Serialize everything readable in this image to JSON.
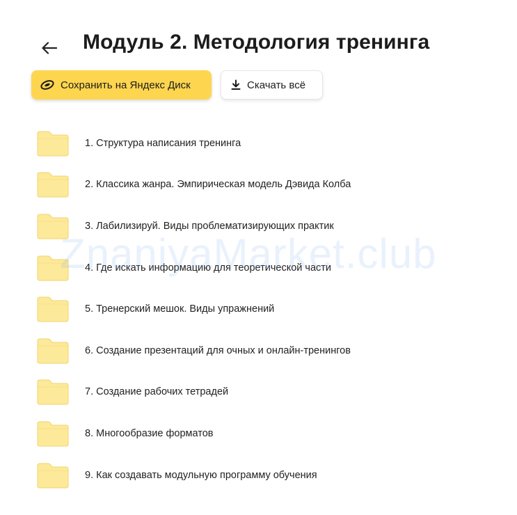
{
  "header": {
    "title": "Модуль 2. Методология тренинга"
  },
  "toolbar": {
    "save_label": "Сохранить на Яндекс Диск",
    "download_label": "Скачать всё"
  },
  "folders": [
    "1. Структура написания тренинга",
    "2. Классика жанра. Эмпирическая модель Дэвида Колба",
    "3. Лабилизируй. Виды проблематизирующих практик",
    "4. Где искать информацию для теоретической части",
    "5. Тренерский мешок. Виды упражнений",
    "6. Создание презентаций для очных и онлайн-тренингов",
    "7. Создание рабочих тетрадей",
    "8. Многообразие форматов",
    "9. Как создавать модульную программу обучения"
  ],
  "watermark": "ZnaniyaMarket.club",
  "colors": {
    "accent": "#fed54f",
    "folder_fill": "#fde99a",
    "folder_stroke": "#f2d36b"
  }
}
